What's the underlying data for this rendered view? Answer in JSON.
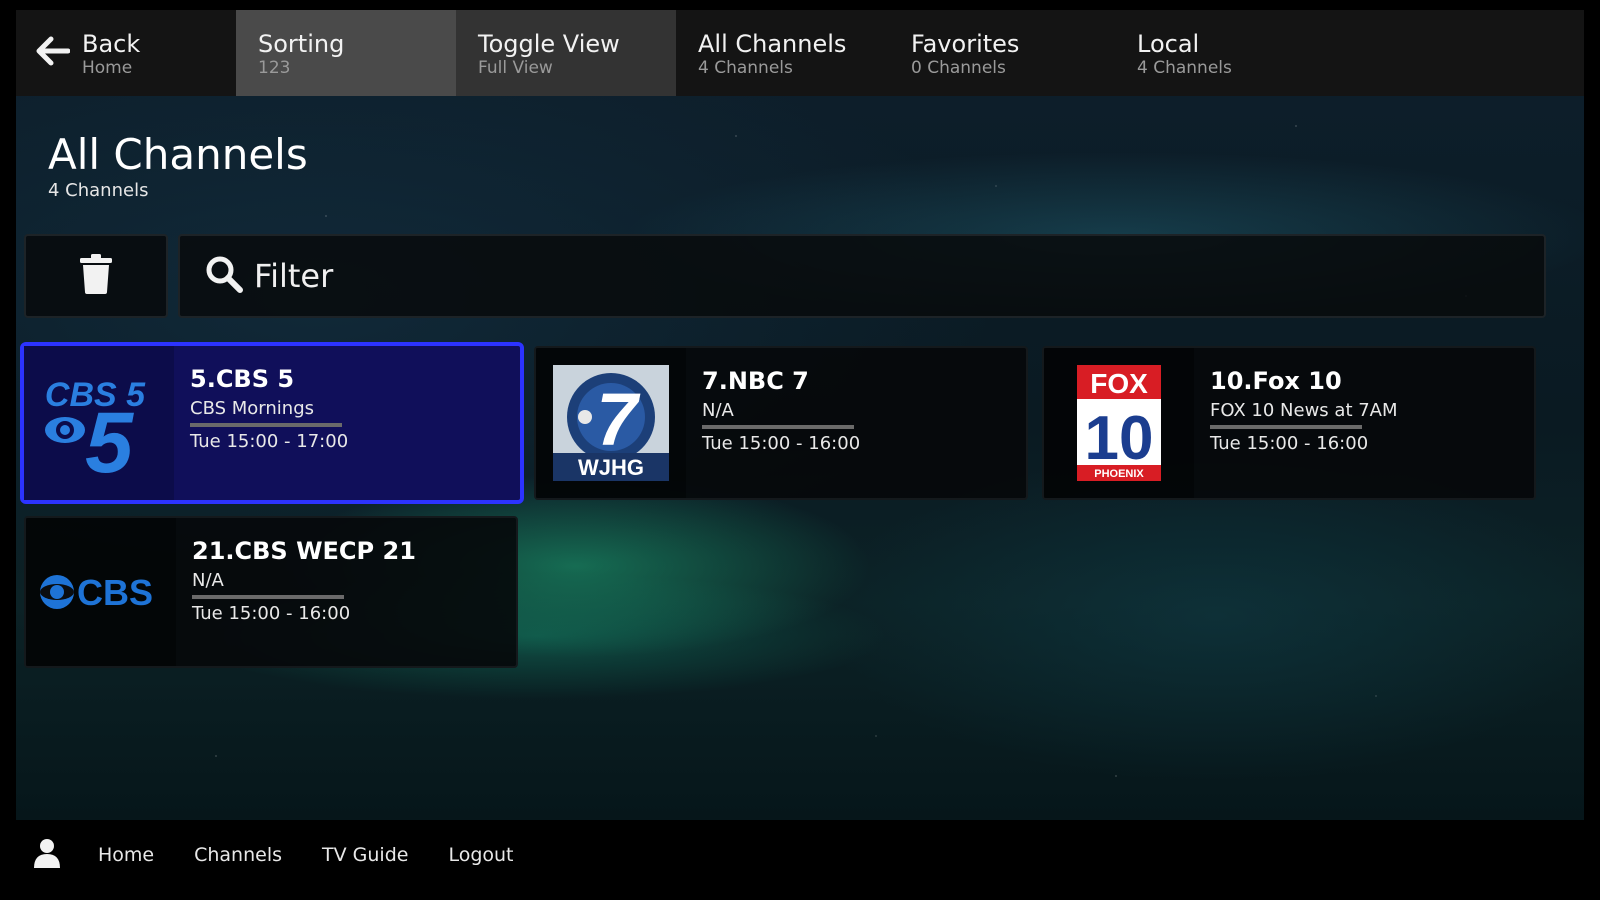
{
  "topbar": {
    "back": {
      "title": "Back",
      "sub": "Home"
    },
    "sorting": {
      "title": "Sorting",
      "sub": "123"
    },
    "toggle": {
      "title": "Toggle View",
      "sub": "Full View"
    },
    "all": {
      "title": "All Channels",
      "sub": "4 Channels"
    },
    "favorites": {
      "title": "Favorites",
      "sub": "0 Channels"
    },
    "local": {
      "title": "Local",
      "sub": "4 Channels"
    }
  },
  "page": {
    "title": "All Channels",
    "subtitle": "4 Channels"
  },
  "filter": {
    "label": "Filter"
  },
  "channels": [
    {
      "name": "5.CBS 5",
      "program": "CBS Mornings",
      "time": "Tue 15:00 - 17:00",
      "logo": "CBS 5",
      "selected": true
    },
    {
      "name": "7.NBC 7",
      "program": "N/A",
      "time": "Tue 15:00 - 16:00",
      "logo": "WJHG"
    },
    {
      "name": "10.Fox 10",
      "program": "FOX 10 News at 7AM",
      "time": "Tue 15:00 - 16:00",
      "logo_top": "FOX",
      "logo_num": "10",
      "logo_bottom": "PHOENIX"
    },
    {
      "name": "21.CBS WECP 21",
      "program": "N/A",
      "time": "Tue 15:00 - 16:00",
      "logo": "CBS"
    }
  ],
  "bottom_nav": {
    "home": "Home",
    "channels": "Channels",
    "tv_guide": "TV Guide",
    "logout": "Logout"
  },
  "colors": {
    "selection_border": "#2c33ff",
    "selected_card_bg": "#100f5a",
    "cbs_blue": "#1e73d6"
  }
}
